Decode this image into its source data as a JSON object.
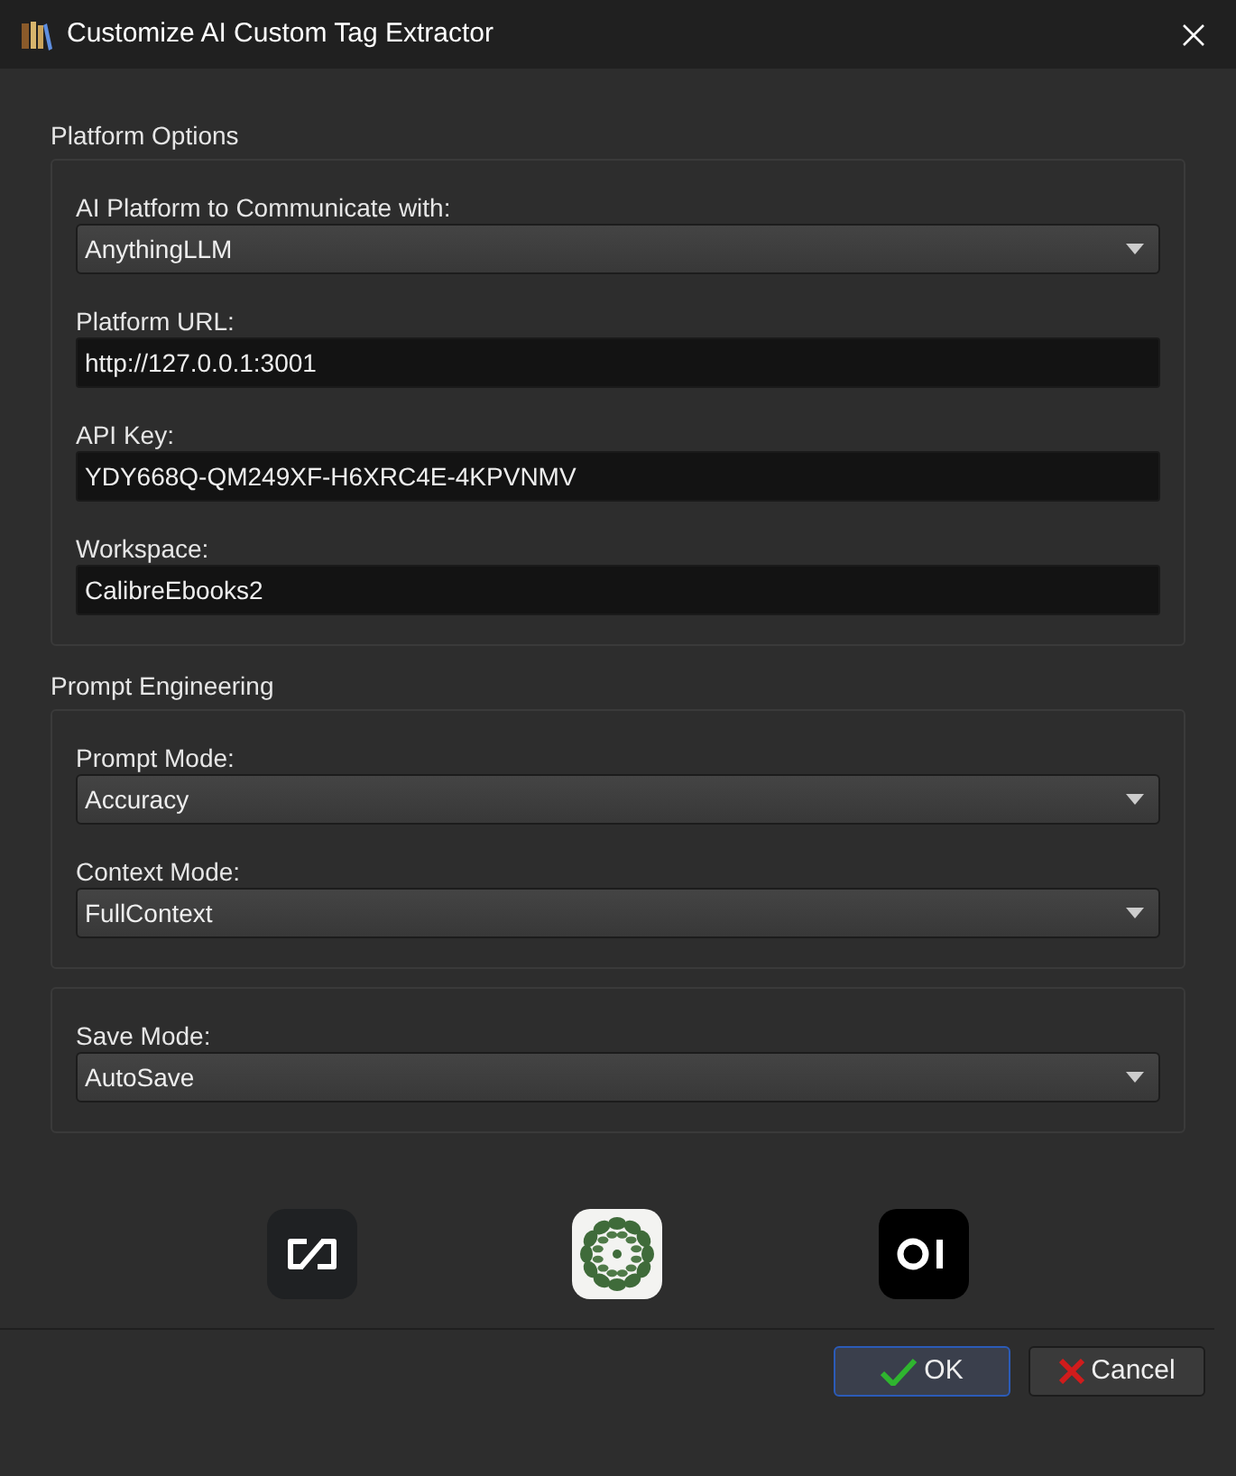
{
  "window": {
    "title": "Customize AI Custom Tag Extractor"
  },
  "groups": [
    {
      "title": "Platform Options",
      "fields": [
        {
          "label": "AI Platform to Communicate with:",
          "kind": "dropdown",
          "value": "AnythingLLM"
        },
        {
          "label": "Platform URL:",
          "kind": "text",
          "value": "http://127.0.0.1:3001"
        },
        {
          "label": "API Key:",
          "kind": "text",
          "value": "YDY668Q-QM249XF-H6XRC4E-4KPVNMV"
        },
        {
          "label": "Workspace:",
          "kind": "text",
          "value": "CalibreEbooks2"
        }
      ]
    },
    {
      "title": "Prompt Engineering",
      "fields": [
        {
          "label": "Prompt Mode:",
          "kind": "dropdown",
          "value": "Accuracy"
        },
        {
          "label": "Context Mode:",
          "kind": "dropdown",
          "value": "FullContext"
        }
      ]
    },
    {
      "fields": [
        {
          "label": "Save Mode:",
          "kind": "dropdown",
          "value": "AutoSave"
        }
      ]
    }
  ],
  "logos": [
    {
      "kind": "link-mark"
    },
    {
      "kind": "flower"
    },
    {
      "kind": "oi-mark"
    }
  ],
  "buttons": [
    {
      "label": "OK",
      "kind": "ok",
      "selected": true
    },
    {
      "label": "Cancel",
      "kind": "cancel",
      "selected": false
    }
  ]
}
